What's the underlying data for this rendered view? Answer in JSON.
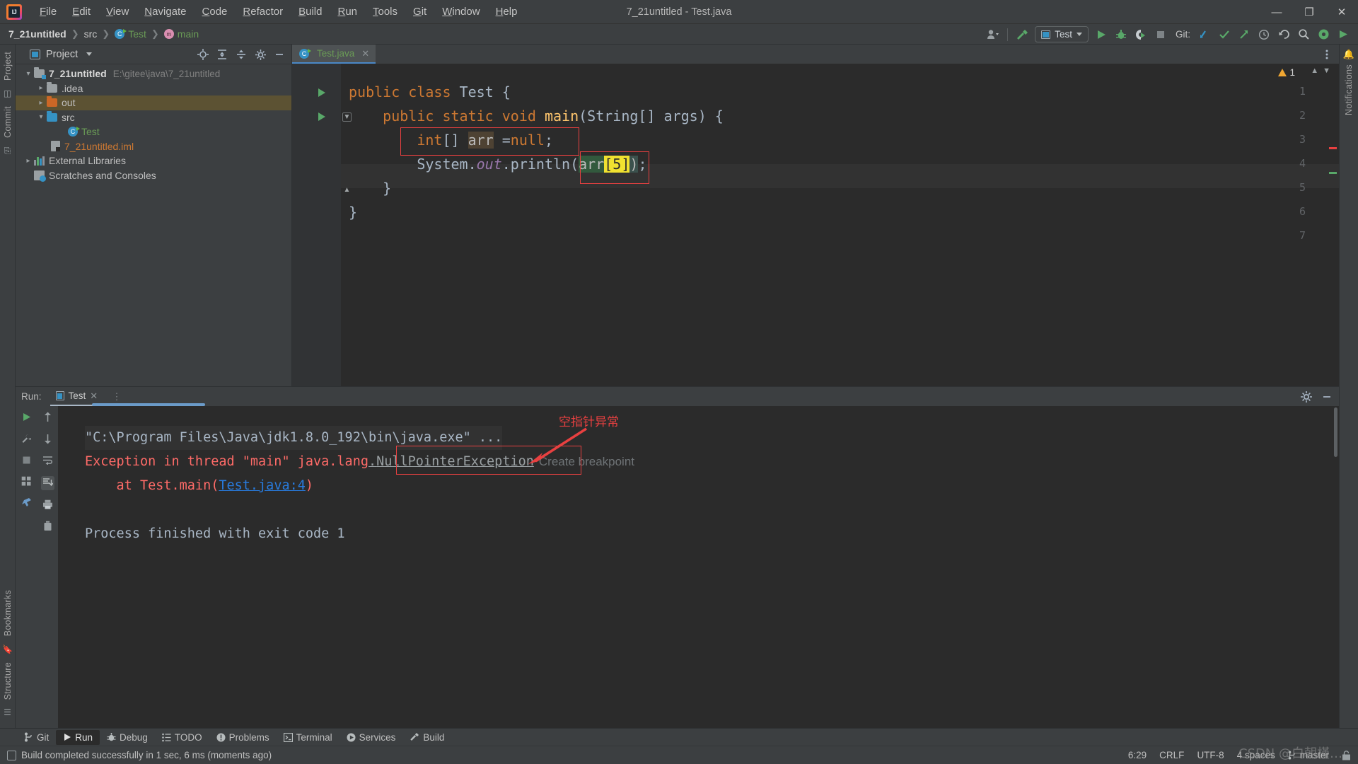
{
  "window": {
    "title": "7_21untitled - Test.java",
    "logo_icon": "intellij-idea-logo",
    "controls": [
      {
        "name": "minimize-button",
        "glyph": "—"
      },
      {
        "name": "maximize-button",
        "glyph": "❐"
      },
      {
        "name": "close-button",
        "glyph": "✕"
      }
    ]
  },
  "menubar": {
    "items": [
      {
        "label": "File",
        "mnemonic": "F"
      },
      {
        "label": "Edit",
        "mnemonic": "E"
      },
      {
        "label": "View",
        "mnemonic": "V"
      },
      {
        "label": "Navigate",
        "mnemonic": "N"
      },
      {
        "label": "Code",
        "mnemonic": "C"
      },
      {
        "label": "Refactor",
        "mnemonic": "R"
      },
      {
        "label": "Build",
        "mnemonic": "B"
      },
      {
        "label": "Run",
        "mnemonic": "R"
      },
      {
        "label": "Tools",
        "mnemonic": "T"
      },
      {
        "label": "Git",
        "mnemonic": "G"
      },
      {
        "label": "Window",
        "mnemonic": "W"
      },
      {
        "label": "Help",
        "mnemonic": "H"
      }
    ]
  },
  "breadcrumb": {
    "project": "7_21untitled",
    "src": "src",
    "class": "Test",
    "method": "main"
  },
  "toolbar": {
    "user_icon": "user-avatar-icon",
    "build_icon": "build-hammer-icon",
    "run_config": "Test",
    "run_icon": "run-play-icon",
    "debug_icon": "debug-bug-icon",
    "coverage_icon": "run-with-coverage-icon",
    "stop_icon": "stop-icon",
    "git_label": "Git:",
    "git_update_icon": "git-update-project-icon",
    "git_commit_icon": "git-commit-checkmark-icon",
    "git_push_icon": "git-push-icon",
    "history_icon": "history-clock-icon",
    "undo_icon": "undo-icon",
    "search_icon": "search-everywhere-icon",
    "settings_icon": "settings-gear-icon",
    "more_icon": "more-options-icon"
  },
  "left_strip": {
    "items": [
      {
        "label": "Project",
        "name": "tool-window-project"
      },
      {
        "label": "Commit",
        "name": "tool-window-commit"
      },
      {
        "label": "Bookmarks",
        "name": "tool-window-bookmarks"
      },
      {
        "label": "Structure",
        "name": "tool-window-structure"
      }
    ]
  },
  "right_strip": {
    "items": [
      {
        "label": "Notifications",
        "name": "tool-window-notifications"
      }
    ]
  },
  "project_panel": {
    "title": "Project",
    "header_icons": [
      "locate-file-icon",
      "expand-all-icon",
      "collapse-all-icon",
      "settings-gear-icon",
      "hide-icon"
    ],
    "tree": [
      {
        "label": "7_21untitled",
        "path": "E:\\gitee\\java\\7_21untitled",
        "indent": 0,
        "arrow": "expanded",
        "icon": "module-folder-icon",
        "style": "bold",
        "selected": false
      },
      {
        "label": ".idea",
        "path": "",
        "indent": 1,
        "arrow": "collapsed",
        "icon": "folder-gray-icon",
        "style": "plain",
        "selected": false
      },
      {
        "label": "out",
        "path": "",
        "indent": 1,
        "arrow": "collapsed",
        "icon": "folder-excluded-icon",
        "style": "plain",
        "selected": true
      },
      {
        "label": "src",
        "path": "",
        "indent": 1,
        "arrow": "expanded",
        "icon": "source-folder-icon",
        "style": "plain",
        "selected": false
      },
      {
        "label": "Test",
        "path": "",
        "indent": 2,
        "arrow": "none",
        "icon": "java-class-runnable-icon",
        "style": "green",
        "selected": false
      },
      {
        "label": "7_21untitled.iml",
        "path": "",
        "indent": 1,
        "arrow": "none",
        "icon": "iml-file-icon",
        "style": "orange",
        "selected": false
      },
      {
        "label": "External Libraries",
        "path": "",
        "indent": 0,
        "arrow": "collapsed",
        "icon": "libraries-icon",
        "style": "plain",
        "selected": false
      },
      {
        "label": "Scratches and Consoles",
        "path": "",
        "indent": 0,
        "arrow": "none",
        "icon": "scratches-icon",
        "style": "plain",
        "selected": false
      }
    ]
  },
  "editor": {
    "tab": {
      "label": "Test.java",
      "icon": "java-class-runnable-icon",
      "close": "✕"
    },
    "warning_count": "1",
    "warning_icon": "warning-triangle-icon",
    "lines": [
      {
        "n": "1",
        "gutter_run": true,
        "text": "public class Test {"
      },
      {
        "n": "2",
        "gutter_run": true,
        "text": "    public static void main(String[] args) {"
      },
      {
        "n": "3",
        "gutter_run": false,
        "text": "        int[] arr =null;"
      },
      {
        "n": "4",
        "gutter_run": false,
        "text": "        System.out.println(arr[5]);"
      },
      {
        "n": "5",
        "gutter_run": false,
        "text": "    }"
      },
      {
        "n": "6",
        "gutter_run": false,
        "text": "}"
      },
      {
        "n": "7",
        "gutter_run": false,
        "text": ""
      }
    ]
  },
  "run_panel": {
    "label": "Run:",
    "tab": "Test",
    "tab_close": "✕",
    "tab_icon": "run-configuration-icon",
    "sidebar_icons": [
      "rerun-icon",
      "scroll-up-icon",
      "wrench-settings-icon",
      "scroll-down-icon",
      "stop-icon",
      "soft-wrap-icon",
      "scroll-to-end-icon",
      "print-icon",
      "clear-all-icon"
    ],
    "header_icons": [
      "settings-gear-icon",
      "hide-icon"
    ],
    "console": {
      "cmd_line": "\"C:\\Program Files\\Java\\jdk1.8.0_192\\bin\\java.exe\" ...",
      "exception_prefix": "Exception in thread \"main\" java.lang",
      "exception_dot": ".",
      "exception_type": "NullPointerException",
      "breakpoint_hint": "Create breakpoint",
      "stack_at": "    at Test.main(",
      "stack_link": "Test.java:4",
      "stack_close": ")",
      "exit_line": "Process finished with exit code 1",
      "annotation": "空指针异常"
    }
  },
  "toolwindow_bar": {
    "items": [
      {
        "label": "Git",
        "icon": "git-branch-icon",
        "active": false
      },
      {
        "label": "Run",
        "icon": "run-play-icon",
        "active": true
      },
      {
        "label": "Debug",
        "icon": "debug-bug-icon",
        "active": false
      },
      {
        "label": "TODO",
        "icon": "todo-list-icon",
        "active": false
      },
      {
        "label": "Problems",
        "icon": "problems-icon",
        "active": false
      },
      {
        "label": "Terminal",
        "icon": "terminal-icon",
        "active": false
      },
      {
        "label": "Services",
        "icon": "services-icon",
        "active": false
      },
      {
        "label": "Build",
        "icon": "build-hammer-icon",
        "active": false
      }
    ]
  },
  "statusbar": {
    "message": "Build completed successfully in 1 sec, 6 ms (moments ago)",
    "message_icon": "build-status-icon",
    "caret_position": "6:29",
    "line_separator": "CRLF",
    "encoding": "UTF-8",
    "indent": "4 spaces",
    "branch": "master",
    "branch_icon": "git-branch-icon",
    "lock_icon": "read-only-toggle-icon",
    "watermark": "CSDN @白朝槿…"
  },
  "colors": {
    "accent_blue": "#3592c4",
    "green": "#59a869",
    "orange": "#cc7832",
    "error_red": "#ff6b68",
    "annotation_red": "#e84040",
    "warning_amber": "#f0a732",
    "panel_bg": "#3c3f41",
    "editor_bg": "#2b2b2b",
    "selection_brown": "#5c5233"
  }
}
